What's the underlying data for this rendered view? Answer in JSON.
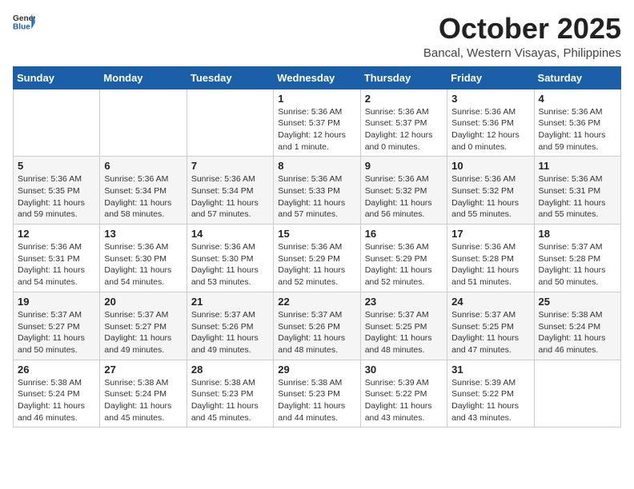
{
  "header": {
    "logo_general": "General",
    "logo_blue": "Blue",
    "month": "October 2025",
    "location": "Bancal, Western Visayas, Philippines"
  },
  "weekdays": [
    "Sunday",
    "Monday",
    "Tuesday",
    "Wednesday",
    "Thursday",
    "Friday",
    "Saturday"
  ],
  "weeks": [
    [
      null,
      null,
      null,
      {
        "day": "1",
        "sunrise": "5:36 AM",
        "sunset": "5:37 PM",
        "daylight": "12 hours and 1 minute."
      },
      {
        "day": "2",
        "sunrise": "5:36 AM",
        "sunset": "5:37 PM",
        "daylight": "12 hours and 0 minutes."
      },
      {
        "day": "3",
        "sunrise": "5:36 AM",
        "sunset": "5:36 PM",
        "daylight": "12 hours and 0 minutes."
      },
      {
        "day": "4",
        "sunrise": "5:36 AM",
        "sunset": "5:36 PM",
        "daylight": "11 hours and 59 minutes."
      }
    ],
    [
      {
        "day": "5",
        "sunrise": "5:36 AM",
        "sunset": "5:35 PM",
        "daylight": "11 hours and 59 minutes."
      },
      {
        "day": "6",
        "sunrise": "5:36 AM",
        "sunset": "5:34 PM",
        "daylight": "11 hours and 58 minutes."
      },
      {
        "day": "7",
        "sunrise": "5:36 AM",
        "sunset": "5:34 PM",
        "daylight": "11 hours and 57 minutes."
      },
      {
        "day": "8",
        "sunrise": "5:36 AM",
        "sunset": "5:33 PM",
        "daylight": "11 hours and 57 minutes."
      },
      {
        "day": "9",
        "sunrise": "5:36 AM",
        "sunset": "5:32 PM",
        "daylight": "11 hours and 56 minutes."
      },
      {
        "day": "10",
        "sunrise": "5:36 AM",
        "sunset": "5:32 PM",
        "daylight": "11 hours and 55 minutes."
      },
      {
        "day": "11",
        "sunrise": "5:36 AM",
        "sunset": "5:31 PM",
        "daylight": "11 hours and 55 minutes."
      }
    ],
    [
      {
        "day": "12",
        "sunrise": "5:36 AM",
        "sunset": "5:31 PM",
        "daylight": "11 hours and 54 minutes."
      },
      {
        "day": "13",
        "sunrise": "5:36 AM",
        "sunset": "5:30 PM",
        "daylight": "11 hours and 54 minutes."
      },
      {
        "day": "14",
        "sunrise": "5:36 AM",
        "sunset": "5:30 PM",
        "daylight": "11 hours and 53 minutes."
      },
      {
        "day": "15",
        "sunrise": "5:36 AM",
        "sunset": "5:29 PM",
        "daylight": "11 hours and 52 minutes."
      },
      {
        "day": "16",
        "sunrise": "5:36 AM",
        "sunset": "5:29 PM",
        "daylight": "11 hours and 52 minutes."
      },
      {
        "day": "17",
        "sunrise": "5:36 AM",
        "sunset": "5:28 PM",
        "daylight": "11 hours and 51 minutes."
      },
      {
        "day": "18",
        "sunrise": "5:37 AM",
        "sunset": "5:28 PM",
        "daylight": "11 hours and 50 minutes."
      }
    ],
    [
      {
        "day": "19",
        "sunrise": "5:37 AM",
        "sunset": "5:27 PM",
        "daylight": "11 hours and 50 minutes."
      },
      {
        "day": "20",
        "sunrise": "5:37 AM",
        "sunset": "5:27 PM",
        "daylight": "11 hours and 49 minutes."
      },
      {
        "day": "21",
        "sunrise": "5:37 AM",
        "sunset": "5:26 PM",
        "daylight": "11 hours and 49 minutes."
      },
      {
        "day": "22",
        "sunrise": "5:37 AM",
        "sunset": "5:26 PM",
        "daylight": "11 hours and 48 minutes."
      },
      {
        "day": "23",
        "sunrise": "5:37 AM",
        "sunset": "5:25 PM",
        "daylight": "11 hours and 48 minutes."
      },
      {
        "day": "24",
        "sunrise": "5:37 AM",
        "sunset": "5:25 PM",
        "daylight": "11 hours and 47 minutes."
      },
      {
        "day": "25",
        "sunrise": "5:38 AM",
        "sunset": "5:24 PM",
        "daylight": "11 hours and 46 minutes."
      }
    ],
    [
      {
        "day": "26",
        "sunrise": "5:38 AM",
        "sunset": "5:24 PM",
        "daylight": "11 hours and 46 minutes."
      },
      {
        "day": "27",
        "sunrise": "5:38 AM",
        "sunset": "5:24 PM",
        "daylight": "11 hours and 45 minutes."
      },
      {
        "day": "28",
        "sunrise": "5:38 AM",
        "sunset": "5:23 PM",
        "daylight": "11 hours and 45 minutes."
      },
      {
        "day": "29",
        "sunrise": "5:38 AM",
        "sunset": "5:23 PM",
        "daylight": "11 hours and 44 minutes."
      },
      {
        "day": "30",
        "sunrise": "5:39 AM",
        "sunset": "5:22 PM",
        "daylight": "11 hours and 43 minutes."
      },
      {
        "day": "31",
        "sunrise": "5:39 AM",
        "sunset": "5:22 PM",
        "daylight": "11 hours and 43 minutes."
      },
      null
    ]
  ]
}
